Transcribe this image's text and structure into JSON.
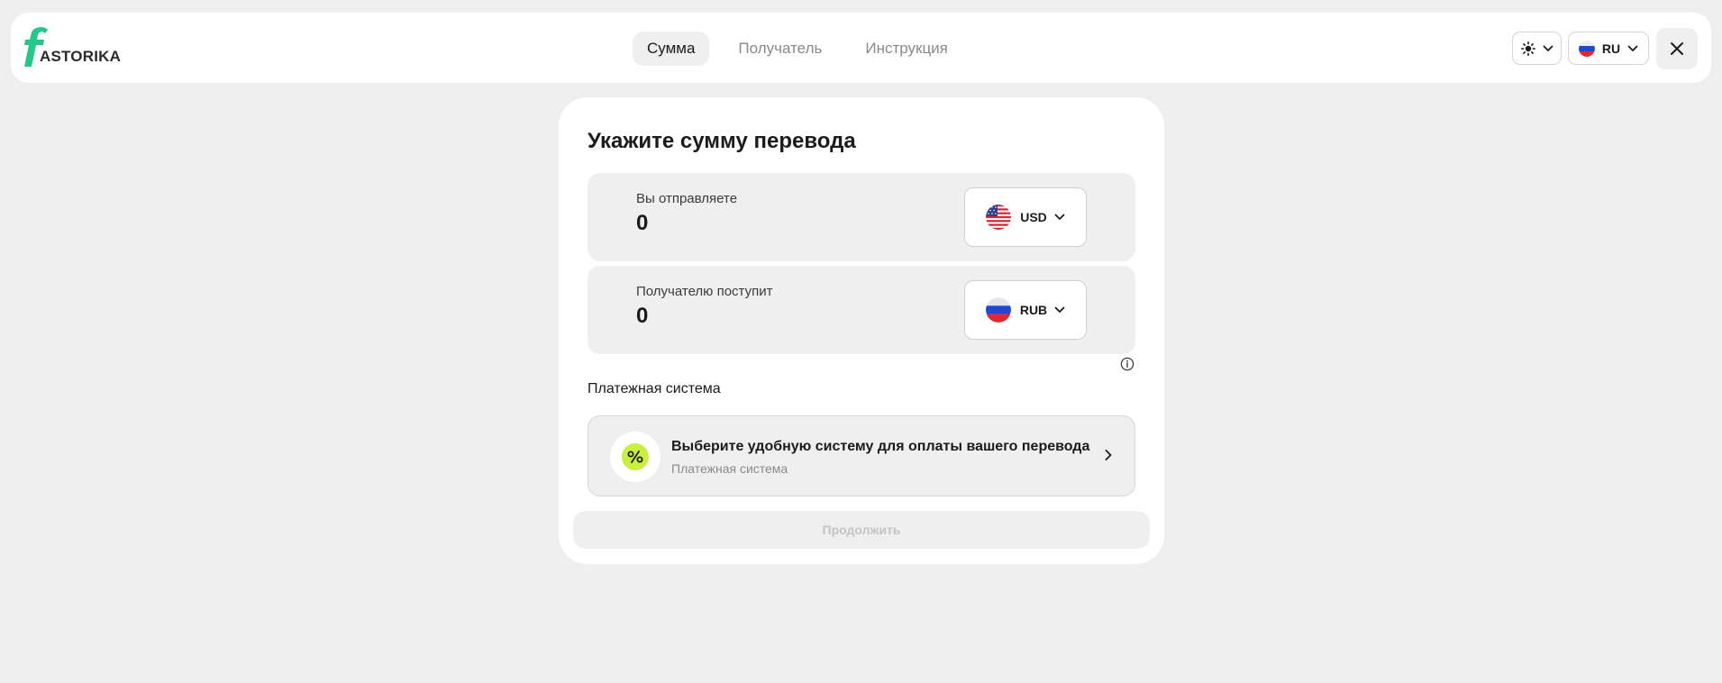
{
  "brand": {
    "logo_text": "ASTORIKA",
    "accent_color": "#22c98a"
  },
  "nav": {
    "tabs": [
      {
        "label": "Сумма",
        "active": true
      },
      {
        "label": "Получатель",
        "active": false
      },
      {
        "label": "Инструкция",
        "active": false
      }
    ]
  },
  "header_controls": {
    "theme_icon": "sun-icon",
    "language": {
      "label": "RU",
      "flag": "russia-flag-icon"
    },
    "close_icon": "close-icon"
  },
  "form": {
    "title": "Укажите сумму перевода",
    "send": {
      "label": "Вы отправляете",
      "value": "0",
      "currency": "USD",
      "flag": "usa-flag-icon"
    },
    "receive": {
      "label": "Получателю поступит",
      "value": "0",
      "currency": "RUB",
      "flag": "russia-flag-icon"
    },
    "payment_heading": "Платежная система",
    "payment_select": {
      "title": "Выберите удобную систему для оплаты вашего перевода",
      "subtitle": "Платежная система",
      "icon": "percent-icon",
      "icon_color": "#c9f03c"
    },
    "continue_label": "Продолжить"
  }
}
